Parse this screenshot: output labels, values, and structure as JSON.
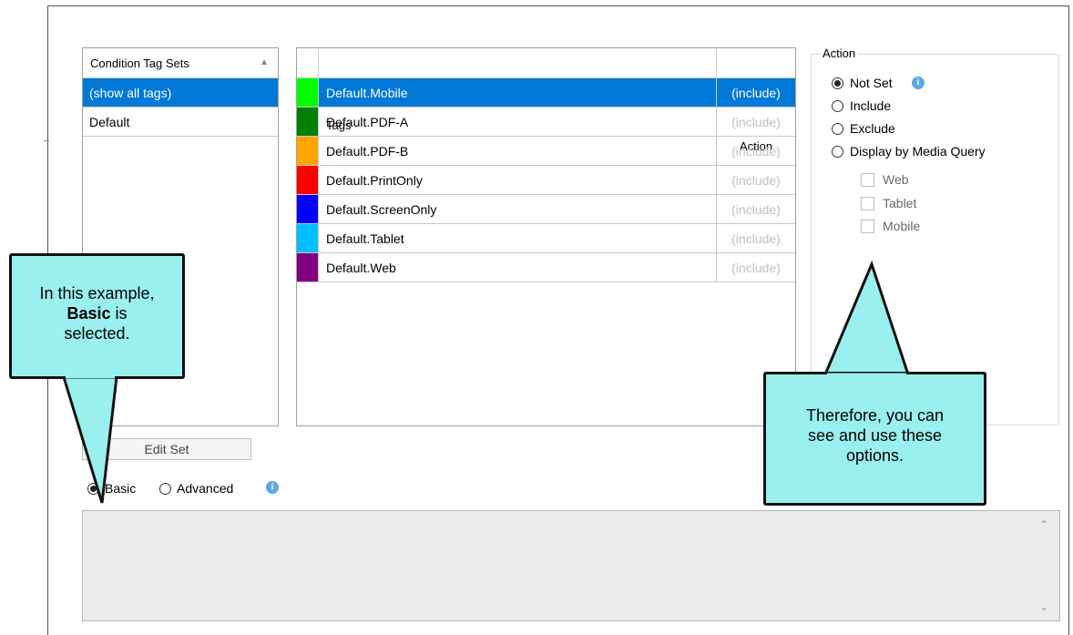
{
  "condition_tag_sets": {
    "header": "Condition Tag Sets",
    "sort_icon": "sort-ascending-icon",
    "items": [
      {
        "label": "(show all tags)",
        "selected": true
      },
      {
        "label": "Default",
        "selected": false
      }
    ]
  },
  "tags_table": {
    "headers": {
      "tags": "Tags",
      "action": "Action"
    },
    "rows": [
      {
        "name": "Default.Mobile",
        "action": "(include)",
        "color": "#00ff00",
        "selected": true
      },
      {
        "name": "Default.PDF-A",
        "action": "(include)",
        "color": "#008000",
        "selected": false
      },
      {
        "name": "Default.PDF-B",
        "action": "(include)",
        "color": "#ffa500",
        "selected": false
      },
      {
        "name": "Default.PrintOnly",
        "action": "(include)",
        "color": "#ff0000",
        "selected": false
      },
      {
        "name": "Default.ScreenOnly",
        "action": "(include)",
        "color": "#0000ff",
        "selected": false
      },
      {
        "name": "Default.Tablet",
        "action": "(include)",
        "color": "#00bfff",
        "selected": false
      },
      {
        "name": "Default.Web",
        "action": "(include)",
        "color": "#800080",
        "selected": false
      }
    ]
  },
  "action_panel": {
    "legend": "Action",
    "options": [
      {
        "label": "Not Set",
        "checked": true
      },
      {
        "label": "Include",
        "checked": false
      },
      {
        "label": "Exclude",
        "checked": false
      },
      {
        "label": "Display by Media Query",
        "checked": false
      }
    ],
    "media_queries": [
      {
        "label": "Web",
        "checked": false
      },
      {
        "label": "Tablet",
        "checked": false
      },
      {
        "label": "Mobile",
        "checked": false
      }
    ]
  },
  "edit_set_label": "Edit Set",
  "mode": {
    "basic_label": "Basic",
    "advanced_label": "Advanced",
    "selected": "Basic"
  },
  "callouts": {
    "left": {
      "pre": "In this example,",
      "bold": "Basic",
      "mid": " is",
      "post": "selected."
    },
    "right": {
      "line1": "Therefore, you can",
      "line2": "see and use these",
      "line3": "options."
    }
  },
  "colors": {
    "selection": "#0078d7",
    "callout_fill": "#9af0ef",
    "info": "#5aa9e6"
  }
}
